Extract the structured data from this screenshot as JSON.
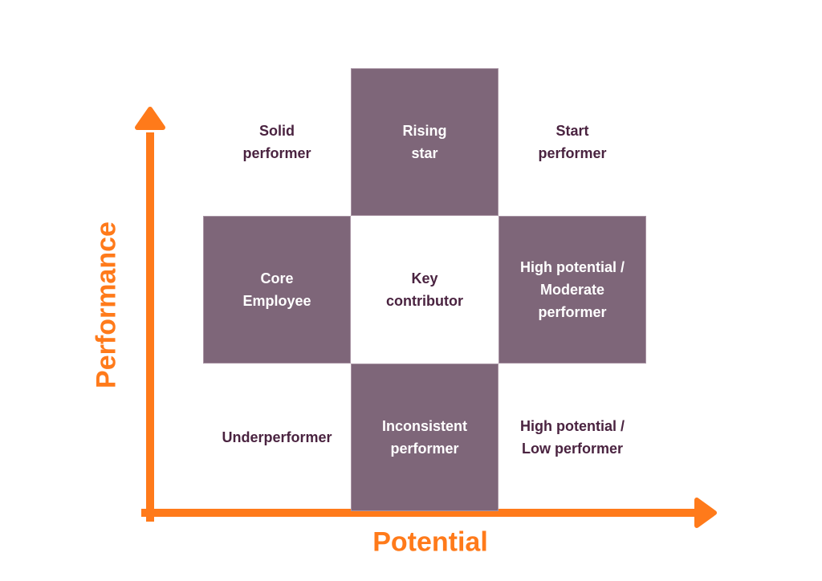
{
  "diagram": {
    "title": "",
    "y_axis_label": "Performance",
    "x_axis_label": "Potential",
    "colors": {
      "axis": "#ff7a1a",
      "filled_cell": "#7e6679",
      "filled_text": "#ffffff",
      "blank_text": "#4a2340"
    },
    "cells": [
      {
        "row": "high",
        "col": "low",
        "label": "Solid\nperformer",
        "filled": false
      },
      {
        "row": "high",
        "col": "moderate",
        "label": "Rising\nstar",
        "filled": true
      },
      {
        "row": "high",
        "col": "high",
        "label": "Start\nperformer",
        "filled": false
      },
      {
        "row": "moderate",
        "col": "low",
        "label": "Core\nEmployee",
        "filled": true
      },
      {
        "row": "moderate",
        "col": "moderate",
        "label": "Key\ncontributor",
        "filled": false
      },
      {
        "row": "moderate",
        "col": "high",
        "label": "High potential /\nModerate\nperformer",
        "filled": true
      },
      {
        "row": "low",
        "col": "low",
        "label": "Underperformer",
        "filled": false
      },
      {
        "row": "low",
        "col": "moderate",
        "label": "Inconsistent\nperformer",
        "filled": true
      },
      {
        "row": "low",
        "col": "high",
        "label": "High potential /\nLow performer",
        "filled": false
      }
    ]
  }
}
